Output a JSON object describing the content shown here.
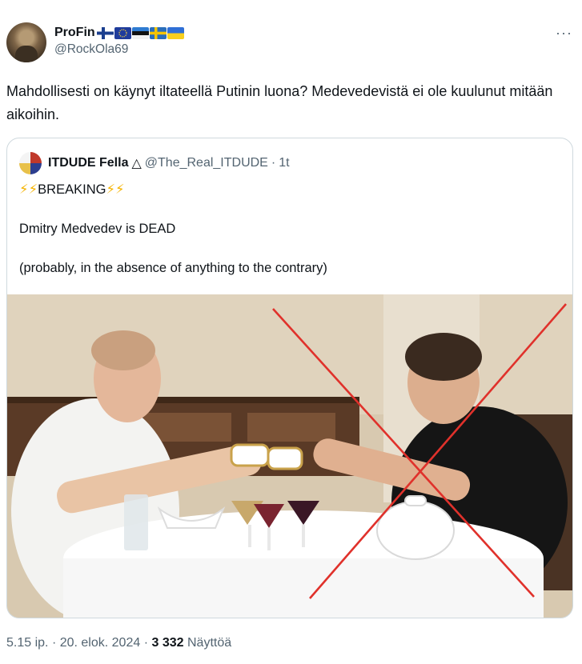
{
  "author": {
    "name": "ProFin",
    "handle": "@RockOla69",
    "flags": [
      "finland-flag",
      "eu-flag",
      "estonia-flag",
      "sweden-flag",
      "ukraine-flag"
    ]
  },
  "tweet": {
    "text": "Mahdollisesti on käynyt iltateellä Putinin luona? Medevedevistä ei ole kuulunut mitään aikoihin."
  },
  "quote": {
    "name": "ITDUDE Fella",
    "badge": "△",
    "handle": "@The_Real_ITDUDE",
    "separator": "·",
    "age": "1t",
    "bolts": "⚡⚡",
    "breaking": "BREAKING",
    "line2": "Dmitry Medvedev is DEAD",
    "line3": "(probably, in the absence of anything to the contrary)"
  },
  "footer": {
    "time": "5.15 ip.",
    "dot1": "·",
    "date": "20. elok. 2024",
    "dot2": "·",
    "views": "3 332",
    "views_label": "Näyttöä"
  },
  "colors": {
    "text": "#0f1419",
    "secondary": "#536471",
    "border": "#cfd9de",
    "cross": "#e0312b"
  }
}
